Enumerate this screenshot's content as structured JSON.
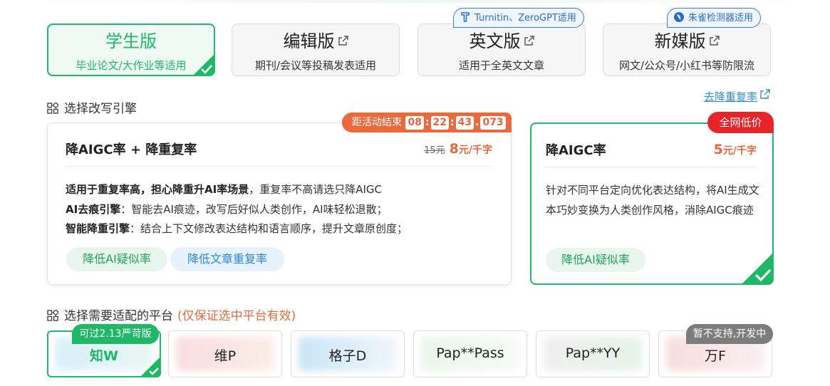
{
  "versions": [
    {
      "title": "学生版",
      "subtitle": "毕业论文/大作业等适用",
      "active": true
    },
    {
      "title": "编辑版",
      "subtitle": "期刊/会议等投稿发表适用",
      "active": false
    },
    {
      "title": "英文版",
      "subtitle": "适用于全英文文章",
      "active": false,
      "badge": "Turnitin、ZeroGPT适用"
    },
    {
      "title": "新媒版",
      "subtitle": "网文/公众号/小红书等防限流",
      "active": false,
      "badge": "朱雀检测器适用"
    }
  ],
  "engine_section": {
    "title": "选择改写引擎",
    "link": "去降重复率"
  },
  "countdown": {
    "label": "距活动结束",
    "hours": "08",
    "minutes": "22",
    "seconds": "43",
    "ms": "073"
  },
  "engines": [
    {
      "title": "降AIGC率 + 降重复率",
      "old_price": "15元",
      "price": "8",
      "price_unit": "元/千字",
      "desc": {
        "line1_bold": "适用于重复率高，担心降重升AI率场景",
        "line1_rest": "，重复率不高请选只降AIGC",
        "line2_bold": "AI去痕引擎",
        "line2_rest": "：智能去AI痕迹，改写后好似人类创作，AI味轻松退散；",
        "line3_bold": "智能降重引擎",
        "line3_rest": "：结合上下文修改表达结构和语言顺序，提升文章原创度；"
      },
      "tags": [
        "降低AI疑似率",
        "降低文章重复率"
      ]
    },
    {
      "title": "降AIGC率",
      "badge": "全网低价",
      "price": "5",
      "price_unit": "元/千字",
      "desc": "针对不同平台定向优化表达结构，将AI生成文本巧妙变换为人类创作风格，消除AIGC痕迹",
      "tags": [
        "降低AI疑似率"
      ]
    }
  ],
  "platform_section": {
    "title": "选择需要适配的平台",
    "hint": "(仅保证选中平台有效)"
  },
  "platforms": [
    {
      "name": "知W",
      "badge": "可过2.13严苛版",
      "active": true
    },
    {
      "name": "维P",
      "active": false
    },
    {
      "name": "格子D",
      "active": false
    },
    {
      "name": "Pap**Pass",
      "active": false
    },
    {
      "name": "Pap**YY",
      "active": false
    },
    {
      "name": "万F",
      "badge": "暂不支持,开发中",
      "active": false
    }
  ],
  "colors": {
    "accent": "#1fb866",
    "orange": "#ea6a3e",
    "red": "#e8242a",
    "blue": "#2f86d6"
  }
}
